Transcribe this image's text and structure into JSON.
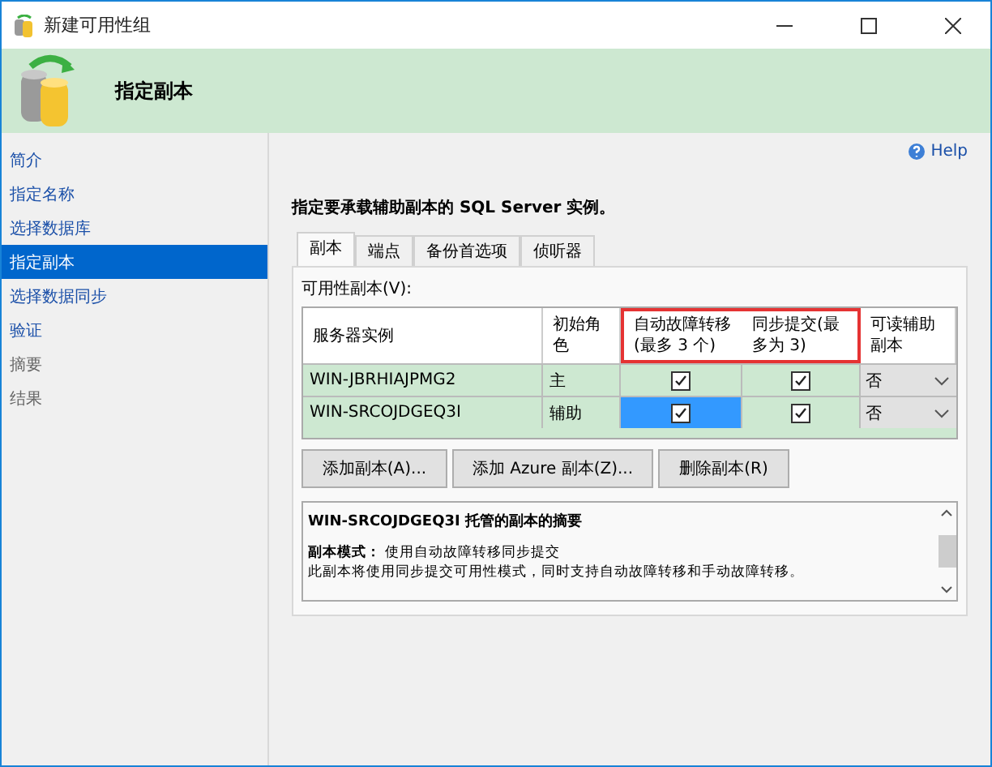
{
  "window": {
    "title": "新建可用性组"
  },
  "header": {
    "title": "指定副本"
  },
  "sidebar": {
    "items": [
      {
        "label": "简介",
        "selected": false,
        "disabled": false
      },
      {
        "label": "指定名称",
        "selected": false,
        "disabled": false
      },
      {
        "label": "选择数据库",
        "selected": false,
        "disabled": false
      },
      {
        "label": "指定副本",
        "selected": true,
        "disabled": false
      },
      {
        "label": "选择数据同步",
        "selected": false,
        "disabled": false
      },
      {
        "label": "验证",
        "selected": false,
        "disabled": false
      },
      {
        "label": "摘要",
        "selected": false,
        "disabled": true
      },
      {
        "label": "结果",
        "selected": false,
        "disabled": true
      }
    ]
  },
  "help": "Help",
  "instruction": "指定要承载辅助副本的 SQL Server 实例。",
  "tabs": [
    {
      "label": "副本",
      "selected": true
    },
    {
      "label": "端点",
      "selected": false
    },
    {
      "label": "备份首选项",
      "selected": false
    },
    {
      "label": "侦听器",
      "selected": false
    }
  ],
  "table": {
    "label": "可用性副本(V):",
    "columns": [
      "服务器实例",
      "初始角色",
      "自动故障转移(最多 3 个)",
      "同步提交(最多为 3)",
      "可读辅助副本"
    ],
    "rows": [
      {
        "server": "WIN-JBRHIAJPMG2",
        "role": "主",
        "auto_failover": {
          "checked": true,
          "selected": false
        },
        "sync_commit": {
          "checked": true,
          "selected": false
        },
        "readable": "否"
      },
      {
        "server": "WIN-SRCOJDGEQ3I",
        "role": "辅助",
        "auto_failover": {
          "checked": true,
          "selected": true
        },
        "sync_commit": {
          "checked": true,
          "selected": false
        },
        "readable": "否"
      }
    ]
  },
  "buttons": [
    "添加副本(A)...",
    "添加 Azure 副本(Z)...",
    "删除副本(R)"
  ],
  "summary": {
    "title": "WIN-SRCOJDGEQ3I 托管的副本的摘要",
    "lines": [
      "**副本模式：** 使用自动故障转移同步提交",
      "此副本将使用同步提交可用性模式，同时支持自动故障转移和手动故障转移。"
    ]
  }
}
